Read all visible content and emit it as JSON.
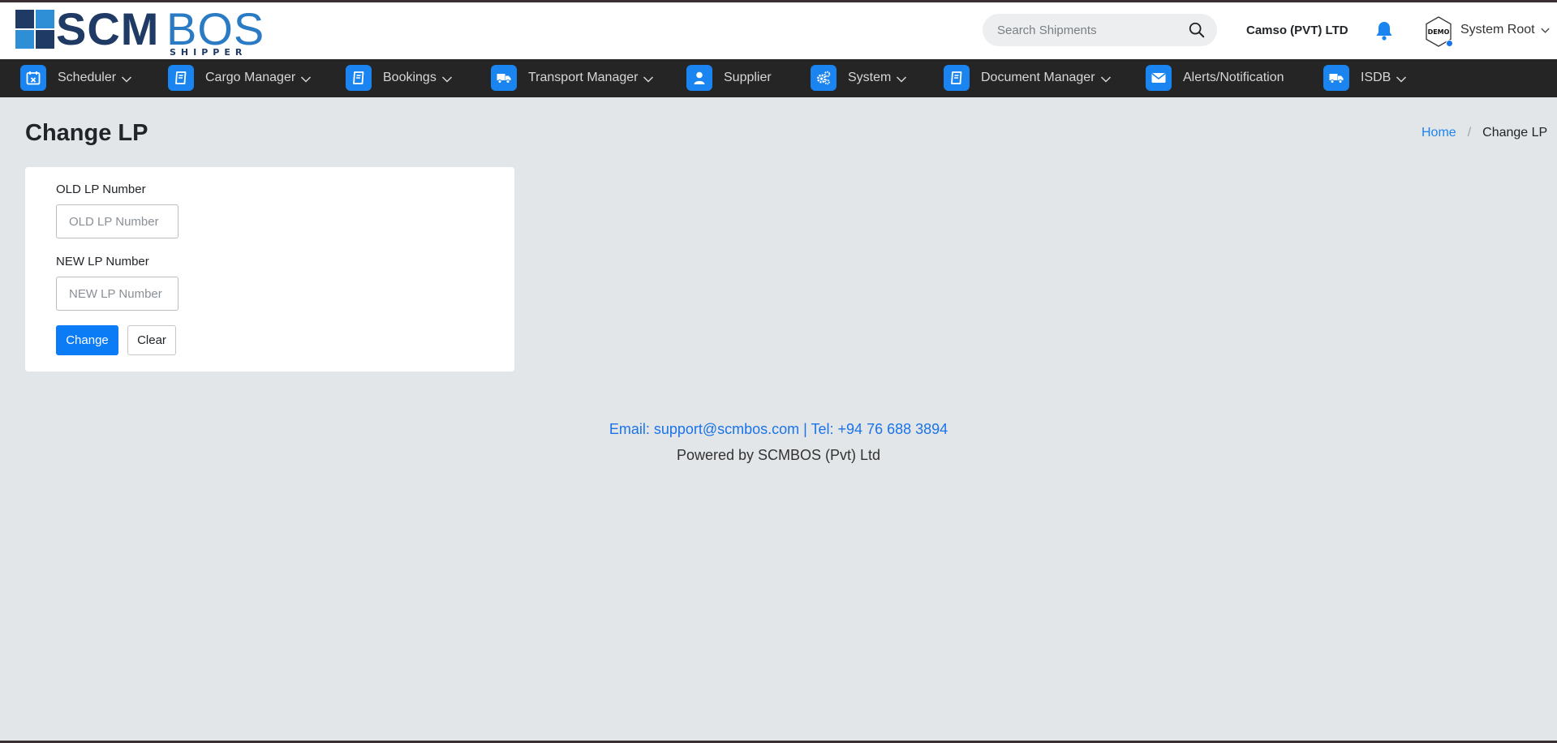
{
  "brand": {
    "logo_main": "SCM",
    "logo_accent": "BOS",
    "logo_sub": "SHIPPER"
  },
  "header": {
    "search_placeholder": "Search Shipments",
    "company": "Camso (PVT) LTD",
    "avatar_text": "DEMO",
    "user": "System Root"
  },
  "nav": {
    "items": [
      {
        "label": "Scheduler",
        "icon": "calendar-icon",
        "dropdown": true
      },
      {
        "label": "Cargo Manager",
        "icon": "book-icon",
        "dropdown": true
      },
      {
        "label": "Bookings",
        "icon": "book-icon",
        "dropdown": true
      },
      {
        "label": "Transport Manager",
        "icon": "truck-icon",
        "dropdown": true
      },
      {
        "label": "Supplier",
        "icon": "user-icon",
        "dropdown": false
      },
      {
        "label": "System",
        "icon": "gears-icon",
        "dropdown": true
      },
      {
        "label": "Document Manager",
        "icon": "book-icon",
        "dropdown": true
      },
      {
        "label": "Alerts/Notification",
        "icon": "envelope-icon",
        "dropdown": false
      },
      {
        "label": "ISDB",
        "icon": "truck-icon",
        "dropdown": true
      }
    ]
  },
  "page": {
    "title": "Change LP",
    "breadcrumb": {
      "home": "Home",
      "separator": "/",
      "current": "Change LP"
    }
  },
  "form": {
    "old_label": "OLD LP Number",
    "old_placeholder": "OLD LP Number",
    "old_value": "",
    "new_label": "NEW LP Number",
    "new_placeholder": "NEW LP Number",
    "new_value": "",
    "change_button": "Change",
    "clear_button": "Clear"
  },
  "footer": {
    "contact": "Email: support@scmbos.com | Tel: +94 76 688 3894",
    "powered": "Powered by SCMBOS (Pvt) Ltd"
  },
  "colors": {
    "accent": "#0b7cf5",
    "nav_bg": "#252525",
    "page_bg": "#e3e6e8"
  }
}
